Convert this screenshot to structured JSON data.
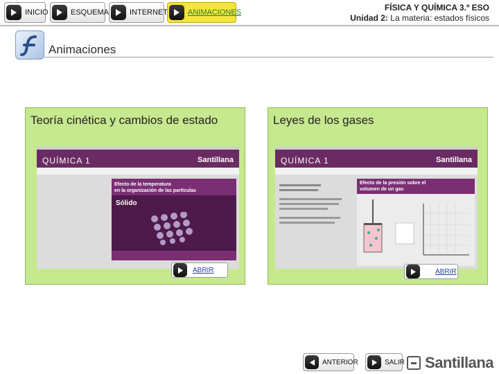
{
  "nav": {
    "inicio": "INICIO",
    "esquema": "ESQUEMA",
    "internet": "INTERNET",
    "animaciones": "ANIMACIONES"
  },
  "header": {
    "course": "FÍSICA Y QUÍMICA 3.º ESO",
    "unit_label": "Unidad 2:",
    "unit_title": "La materia: estados físicos"
  },
  "section": {
    "title": "Animaciones"
  },
  "panels": [
    {
      "title": "Teoría cinética y cambios de estado",
      "open_label": "ABRIR",
      "thumb": {
        "header": "QUÍMICA 1",
        "brand": "Santillana",
        "card_title_1": "Efecto de la temperatura",
        "card_title_2": "en la organización de las partículas",
        "state_label": "Sólido"
      }
    },
    {
      "title": "Leyes de los gases",
      "open_label": "ABRIR",
      "thumb": {
        "header": "QUÍMICA 1",
        "brand": "Santillana",
        "card_title_1": "Efecto de la presión sobre el",
        "card_title_2": "volumen de un gas"
      }
    }
  ],
  "footer": {
    "previous": "ANTERIOR",
    "exit": "SALIR",
    "logo": "Santillana"
  },
  "colors": {
    "panel_bg": "#c6e88e",
    "active_nav": "#f3e53a",
    "thumb_header": "#6a2b63",
    "link": "#2a3ea5"
  }
}
